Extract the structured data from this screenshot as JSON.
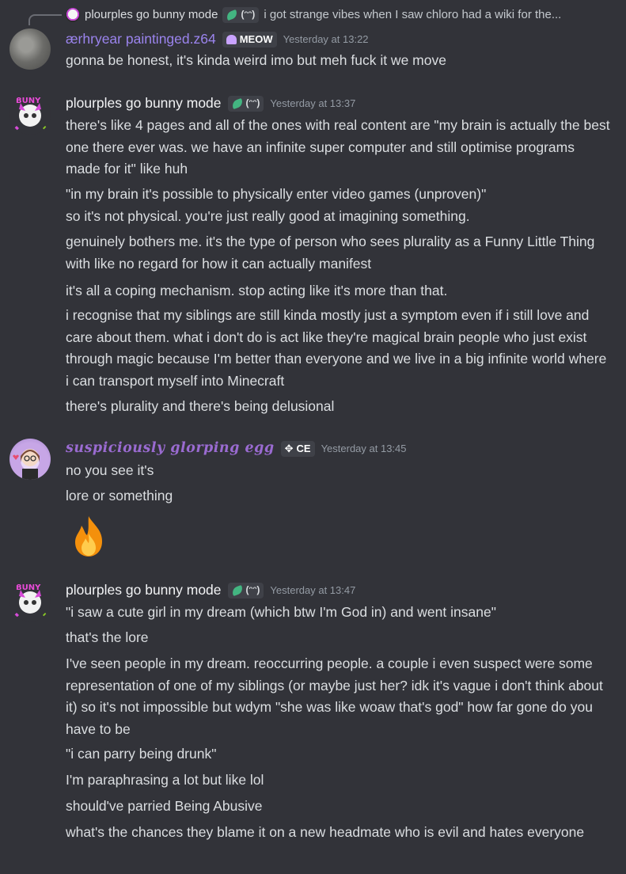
{
  "reply": {
    "author": "plourples go bunny mode",
    "text": "i got strange vibes when I saw chloro had a wiki for the..."
  },
  "messages": [
    {
      "author": "ærhryear paintinged.z64",
      "tag": "MEOW",
      "timestamp": "Yesterday at 13:22",
      "lines": [
        "gonna be honest, it's kinda weird imo but meh fuck it we move"
      ]
    },
    {
      "author": "plourples go bunny mode",
      "timestamp": "Yesterday at 13:37",
      "lines": [
        "there's like 4 pages and all of the ones with real content are \"my brain is actually the best one there ever was. we have an infinite super computer and still optimise programs made for it\" like huh",
        "\"in my brain it's possible to physically enter video games (unproven)\"",
        "so it's not physical. you're just really good at imagining something.",
        "genuinely bothers me. it's the type of person who sees plurality as a Funny Little Thing with like no regard for how it can actually manifest",
        "it's all a coping mechanism. stop acting like it's more than that.",
        "i recognise that my siblings are still kinda mostly just a symptom even if i still love and care about them. what i don't do is act like they're magical brain people who just exist through magic because I'm better than everyone and we live in a big infinite world where i can transport myself into Minecraft",
        "there's plurality and there's being delusional"
      ]
    },
    {
      "author": "suspiciously glorping egg",
      "tag": "CE",
      "timestamp": "Yesterday at 13:45",
      "lines": [
        "no you see it's",
        "lore or something"
      ],
      "emoji": "fire-emoji"
    },
    {
      "author": "plourples go bunny mode",
      "timestamp": "Yesterday at 13:47",
      "lines": [
        "\"i saw a cute girl in my dream (which btw I'm God in) and went insane\"",
        "that's the lore",
        "I've seen people in my dream. reoccurring people. a couple i even suspect were some representation of one of my siblings (or maybe just her? idk it's vague i don't think about it) so it's not impossible but wdym \"she was like woaw that's god\" how far gone do you have to be",
        "\"i can parry being drunk\"",
        "I'm paraphrasing a lot but like lol",
        "should've parried Being Abusive",
        "what's the chances they blame it on a new headmate who is evil and hates everyone"
      ]
    }
  ]
}
